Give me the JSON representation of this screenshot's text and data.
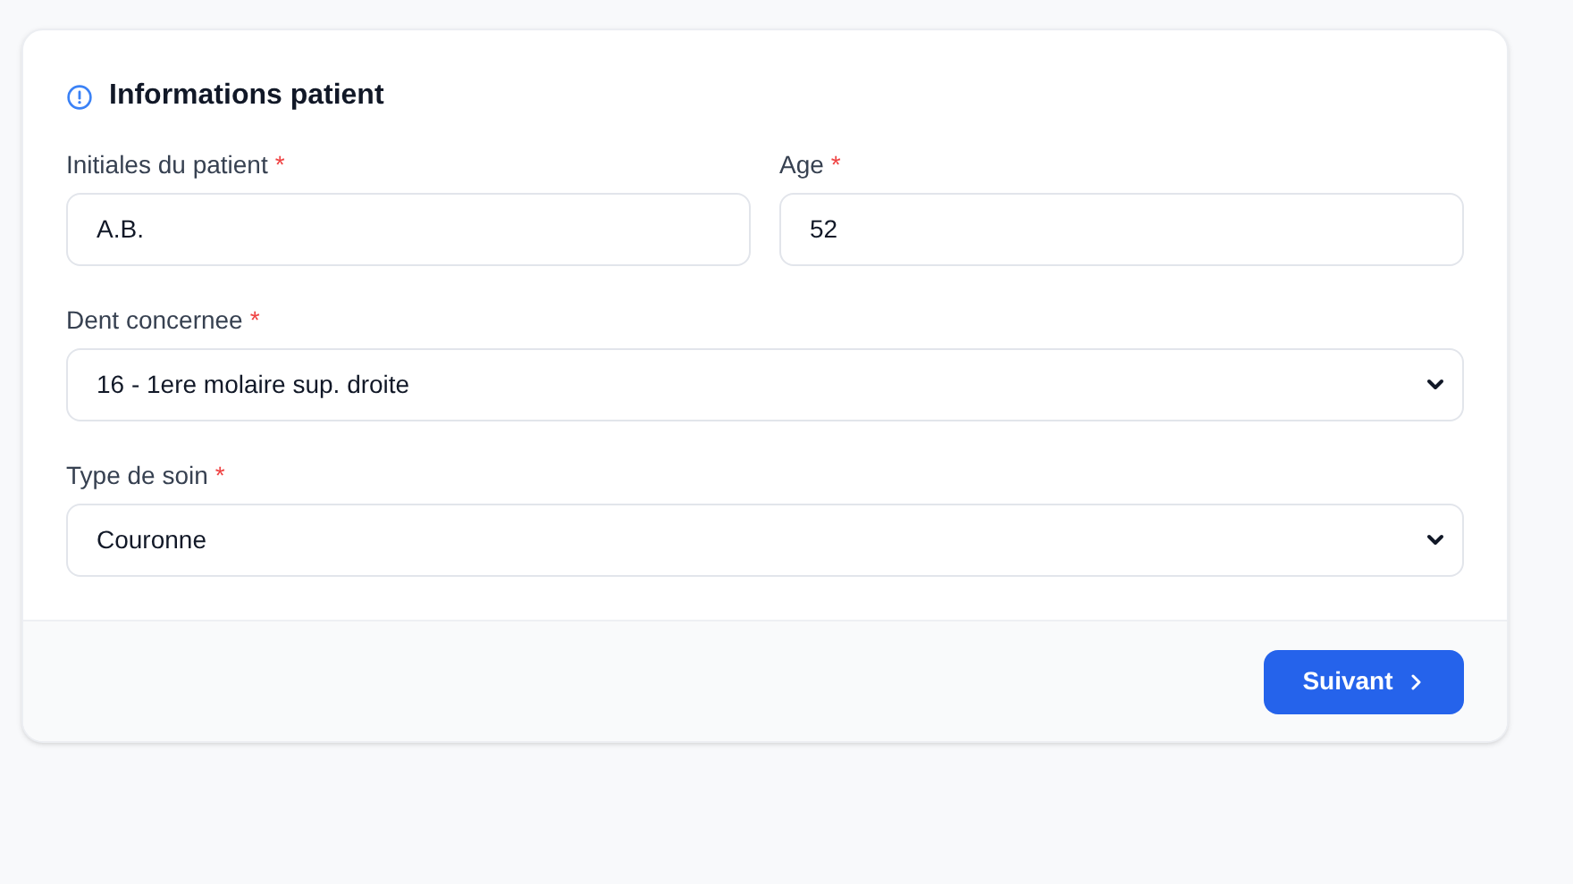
{
  "card": {
    "title": "Informations patient",
    "rows": [
      {
        "fields": [
          {
            "label": "Initiales du patient",
            "required_mark": "*",
            "kind": "text",
            "value": "A.B."
          },
          {
            "label": "Age",
            "required_mark": "*",
            "kind": "text",
            "value": "52"
          }
        ]
      },
      {
        "fields": [
          {
            "label": "Dent concernee",
            "required_mark": "*",
            "kind": "select",
            "value": "16 - 1ere molaire sup. droite"
          }
        ]
      },
      {
        "fields": [
          {
            "label": "Type de soin",
            "required_mark": "*",
            "kind": "select",
            "value": "Couronne"
          }
        ]
      }
    ],
    "next_button": {
      "label": "Suivant"
    }
  }
}
